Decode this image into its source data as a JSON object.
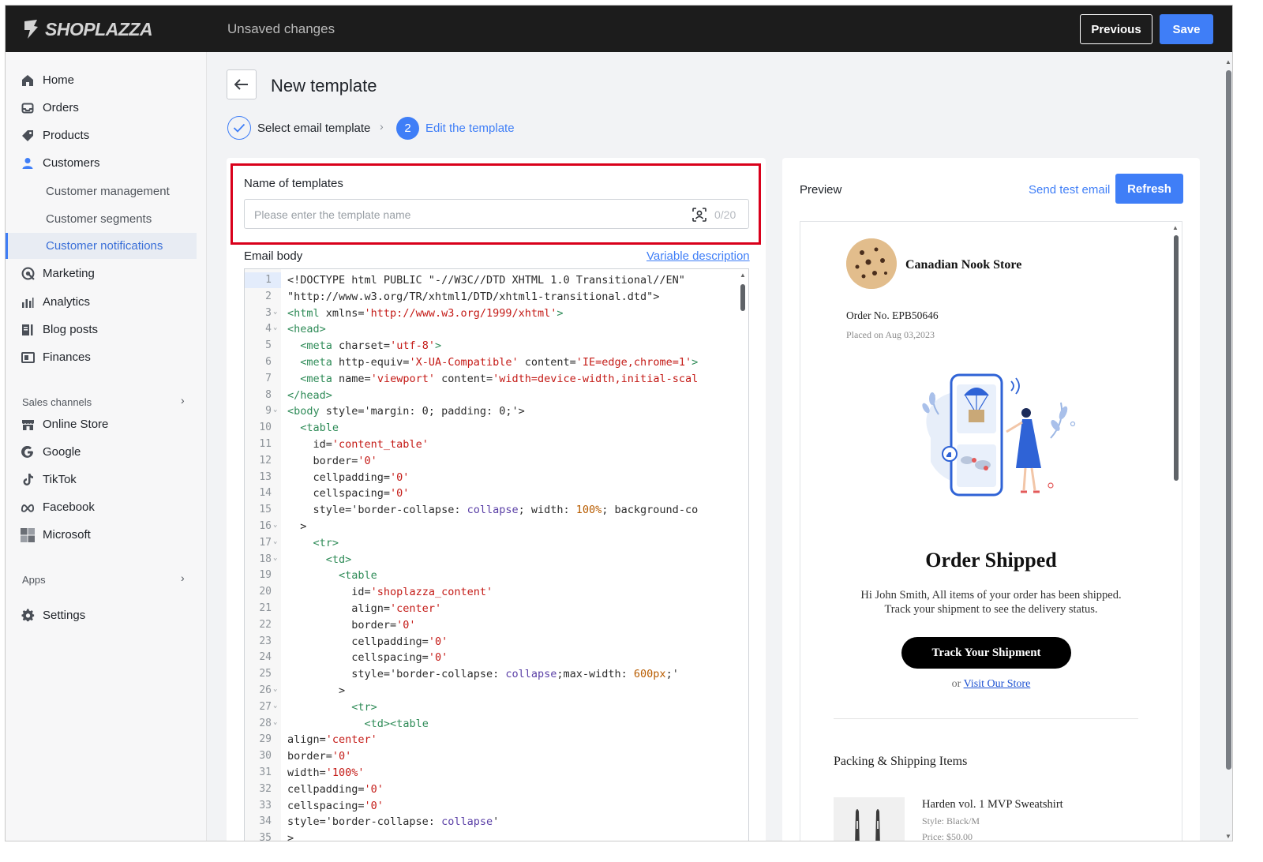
{
  "topbar": {
    "logo_text": "SHOPLAZZA",
    "status": "Unsaved changes",
    "previous_label": "Previous",
    "save_label": "Save"
  },
  "sidebar": {
    "items": [
      {
        "label": "Home",
        "icon": "home-icon"
      },
      {
        "label": "Orders",
        "icon": "inbox-icon"
      },
      {
        "label": "Products",
        "icon": "tag-icon"
      },
      {
        "label": "Customers",
        "icon": "person-icon"
      }
    ],
    "customer_sub": [
      {
        "label": "Customer management"
      },
      {
        "label": "Customer segments"
      },
      {
        "label": "Customer notifications",
        "active": true
      }
    ],
    "items2": [
      {
        "label": "Marketing",
        "icon": "target-icon"
      },
      {
        "label": "Analytics",
        "icon": "bar-chart-icon"
      },
      {
        "label": "Blog posts",
        "icon": "blog-icon"
      },
      {
        "label": "Finances",
        "icon": "wallet-icon"
      }
    ],
    "sales_channels_label": "Sales channels",
    "channels": [
      {
        "label": "Online Store",
        "icon": "store-icon"
      },
      {
        "label": "Google",
        "icon": "google-icon"
      },
      {
        "label": "TikTok",
        "icon": "tiktok-icon"
      },
      {
        "label": "Facebook",
        "icon": "meta-icon"
      },
      {
        "label": "Microsoft",
        "icon": "microsoft-icon"
      }
    ],
    "apps_label": "Apps",
    "settings_label": "Settings"
  },
  "main": {
    "title": "New template",
    "steps": [
      {
        "label": "Select email template",
        "state": "done"
      },
      {
        "number": "2",
        "label": "Edit the template",
        "state": "active"
      }
    ],
    "name_field": {
      "label": "Name of templates",
      "placeholder": "Please enter the template name",
      "value": "",
      "counter": "0/20"
    },
    "email_body_label": "Email body",
    "variable_link": "Variable description",
    "code_lines": [
      {
        "n": "1",
        "fold": false,
        "segs": [
          [
            "p",
            "<!DOCTYPE html PUBLIC \"-//W3C//DTD XHTML 1.0 Transitional//EN\""
          ]
        ]
      },
      {
        "n": "2",
        "fold": false,
        "segs": [
          [
            "p",
            "\"http://www.w3.org/TR/xhtml1/DTD/xhtml1-transitional.dtd\">"
          ]
        ]
      },
      {
        "n": "3",
        "fold": true,
        "segs": [
          [
            "g",
            "<html"
          ],
          [
            "p",
            " xmlns="
          ],
          [
            "s",
            "'http://www.w3.org/1999/xhtml'"
          ],
          [
            "g",
            ">"
          ]
        ]
      },
      {
        "n": "4",
        "fold": true,
        "segs": [
          [
            "g",
            "<head>"
          ]
        ]
      },
      {
        "n": "5",
        "fold": false,
        "segs": [
          [
            "p",
            "  "
          ],
          [
            "g",
            "<meta"
          ],
          [
            "p",
            " charset="
          ],
          [
            "s",
            "'utf-8'"
          ],
          [
            "g",
            ">"
          ]
        ]
      },
      {
        "n": "6",
        "fold": false,
        "segs": [
          [
            "p",
            "  "
          ],
          [
            "g",
            "<meta"
          ],
          [
            "p",
            " http-equiv="
          ],
          [
            "s",
            "'X-UA-Compatible'"
          ],
          [
            "p",
            " content="
          ],
          [
            "s",
            "'IE=edge,chrome=1'"
          ],
          [
            "g",
            ">"
          ]
        ]
      },
      {
        "n": "7",
        "fold": false,
        "segs": [
          [
            "p",
            "  "
          ],
          [
            "g",
            "<meta"
          ],
          [
            "p",
            " name="
          ],
          [
            "s",
            "'viewport'"
          ],
          [
            "p",
            " content="
          ],
          [
            "s",
            "'width=device-width,initial-scal"
          ]
        ]
      },
      {
        "n": "8",
        "fold": false,
        "segs": [
          [
            "g",
            "</head>"
          ]
        ]
      },
      {
        "n": "9",
        "fold": true,
        "segs": [
          [
            "g",
            "<body"
          ],
          [
            "p",
            " style='margin: 0; padding: 0;'>"
          ]
        ]
      },
      {
        "n": "10",
        "fold": false,
        "segs": [
          [
            "p",
            "  "
          ],
          [
            "g",
            "<table"
          ]
        ]
      },
      {
        "n": "11",
        "fold": false,
        "segs": [
          [
            "p",
            "    id="
          ],
          [
            "s",
            "'content_table'"
          ]
        ]
      },
      {
        "n": "12",
        "fold": false,
        "segs": [
          [
            "p",
            "    border="
          ],
          [
            "s",
            "'0'"
          ]
        ]
      },
      {
        "n": "13",
        "fold": false,
        "segs": [
          [
            "p",
            "    cellpadding="
          ],
          [
            "s",
            "'0'"
          ]
        ]
      },
      {
        "n": "14",
        "fold": false,
        "segs": [
          [
            "p",
            "    cellspacing="
          ],
          [
            "s",
            "'0'"
          ]
        ]
      },
      {
        "n": "15",
        "fold": false,
        "segs": [
          [
            "p",
            "    style='border-collapse: "
          ],
          [
            "v",
            "collapse"
          ],
          [
            "p",
            "; width: "
          ],
          [
            "n",
            "100%"
          ],
          [
            "p",
            "; background-co"
          ]
        ]
      },
      {
        "n": "16",
        "fold": true,
        "segs": [
          [
            "p",
            "  >"
          ]
        ]
      },
      {
        "n": "17",
        "fold": true,
        "segs": [
          [
            "p",
            "    "
          ],
          [
            "g",
            "<tr>"
          ]
        ]
      },
      {
        "n": "18",
        "fold": true,
        "segs": [
          [
            "p",
            "      "
          ],
          [
            "g",
            "<td>"
          ]
        ]
      },
      {
        "n": "19",
        "fold": false,
        "segs": [
          [
            "p",
            "        "
          ],
          [
            "g",
            "<table"
          ]
        ]
      },
      {
        "n": "20",
        "fold": false,
        "segs": [
          [
            "p",
            "          id="
          ],
          [
            "s",
            "'shoplazza_content'"
          ]
        ]
      },
      {
        "n": "21",
        "fold": false,
        "segs": [
          [
            "p",
            "          align="
          ],
          [
            "s",
            "'center'"
          ]
        ]
      },
      {
        "n": "22",
        "fold": false,
        "segs": [
          [
            "p",
            "          border="
          ],
          [
            "s",
            "'0'"
          ]
        ]
      },
      {
        "n": "23",
        "fold": false,
        "segs": [
          [
            "p",
            "          cellpadding="
          ],
          [
            "s",
            "'0'"
          ]
        ]
      },
      {
        "n": "24",
        "fold": false,
        "segs": [
          [
            "p",
            "          cellspacing="
          ],
          [
            "s",
            "'0'"
          ]
        ]
      },
      {
        "n": "25",
        "fold": false,
        "segs": [
          [
            "p",
            "          style='border-collapse: "
          ],
          [
            "v",
            "collapse"
          ],
          [
            "p",
            ";max-width: "
          ],
          [
            "n",
            "600px"
          ],
          [
            "p",
            ";'"
          ]
        ]
      },
      {
        "n": "26",
        "fold": true,
        "segs": [
          [
            "p",
            "        >"
          ]
        ]
      },
      {
        "n": "27",
        "fold": true,
        "segs": [
          [
            "p",
            "          "
          ],
          [
            "g",
            "<tr>"
          ]
        ]
      },
      {
        "n": "28",
        "fold": true,
        "segs": [
          [
            "p",
            "            "
          ],
          [
            "g",
            "<td><table"
          ]
        ]
      },
      {
        "n": "29",
        "fold": false,
        "segs": [
          [
            "p",
            "align="
          ],
          [
            "s",
            "'center'"
          ]
        ]
      },
      {
        "n": "30",
        "fold": false,
        "segs": [
          [
            "p",
            "border="
          ],
          [
            "s",
            "'0'"
          ]
        ]
      },
      {
        "n": "31",
        "fold": false,
        "segs": [
          [
            "p",
            "width="
          ],
          [
            "s",
            "'100%'"
          ]
        ]
      },
      {
        "n": "32",
        "fold": false,
        "segs": [
          [
            "p",
            "cellpadding="
          ],
          [
            "s",
            "'0'"
          ]
        ]
      },
      {
        "n": "33",
        "fold": false,
        "segs": [
          [
            "p",
            "cellspacing="
          ],
          [
            "s",
            "'0'"
          ]
        ]
      },
      {
        "n": "34",
        "fold": false,
        "segs": [
          [
            "p",
            "style='border-collapse: "
          ],
          [
            "v",
            "collapse"
          ],
          [
            "p",
            "'"
          ]
        ]
      },
      {
        "n": "35",
        "fold": false,
        "segs": [
          [
            "p",
            ">"
          ]
        ]
      }
    ]
  },
  "preview": {
    "title": "Preview",
    "send_test": "Send test email",
    "refresh": "Refresh",
    "store_name": "Canadian Nook Store",
    "order_no": "Order No. EPB50646",
    "placed_on": "Placed on Aug 03,2023",
    "heading": "Order Shipped",
    "message_line1": "Hi John Smith, All items of your order has been shipped.",
    "message_line2": "Track your shipment to see the delivery status.",
    "track_button": "Track Your Shipment",
    "or_text": "or ",
    "visit_link": "Visit Our Store",
    "packing_title": "Packing & Shipping Items",
    "item": {
      "name": "Harden vol. 1 MVP Sweatshirt",
      "style": "Style: Black/M",
      "price": "Price: $50.00"
    }
  },
  "colors": {
    "accent": "#3f7ef7",
    "topbar": "#1c1c1c",
    "highlight": "#d9001b"
  }
}
